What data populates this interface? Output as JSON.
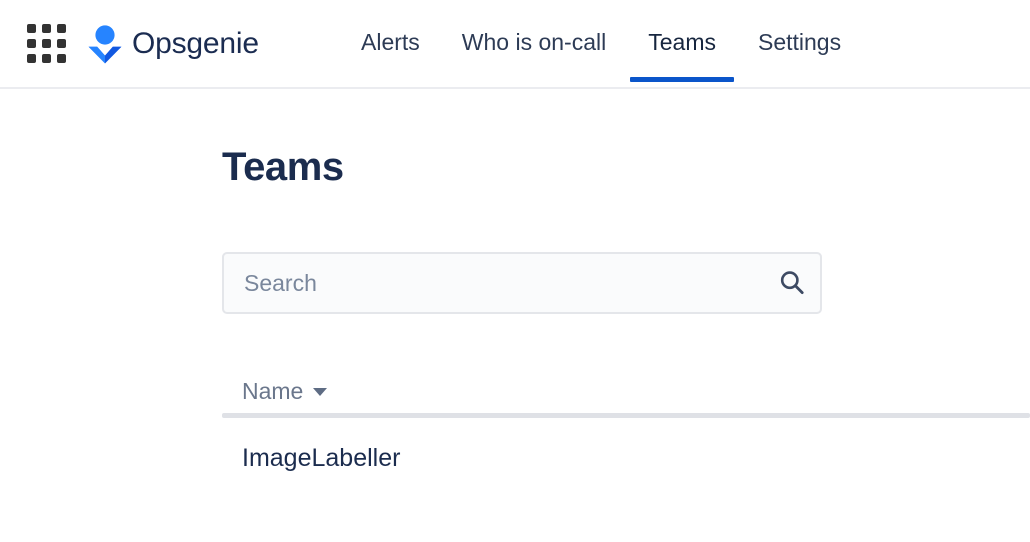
{
  "header": {
    "app_switcher_icon": "grid-apps-icon",
    "brand_logo_icon": "opsgenie-logo-icon",
    "brand_name": "Opsgenie",
    "nav_items": [
      {
        "label": "Alerts",
        "active": false
      },
      {
        "label": "Who is on-call",
        "active": false
      },
      {
        "label": "Teams",
        "active": true
      },
      {
        "label": "Settings",
        "active": false
      }
    ],
    "active_underline_color": "#0a55ca"
  },
  "main": {
    "page_title": "Teams",
    "search": {
      "value": "",
      "placeholder": "Search",
      "icon": "search-icon"
    },
    "table": {
      "columns": [
        {
          "label": "Name",
          "sort_icon": "chevron-down-icon",
          "sortable": true
        }
      ],
      "rows": [
        {
          "name": "ImageLabeller"
        }
      ]
    }
  },
  "colors": {
    "brand_blue": "#2684ff",
    "brand_blue_dark": "#0a55ca",
    "text_dark": "#1b2c4e",
    "text_muted": "#6b778c",
    "divider": "#dfe1e6",
    "field_bg": "#fafbfc",
    "field_border": "#e4e6ea"
  }
}
